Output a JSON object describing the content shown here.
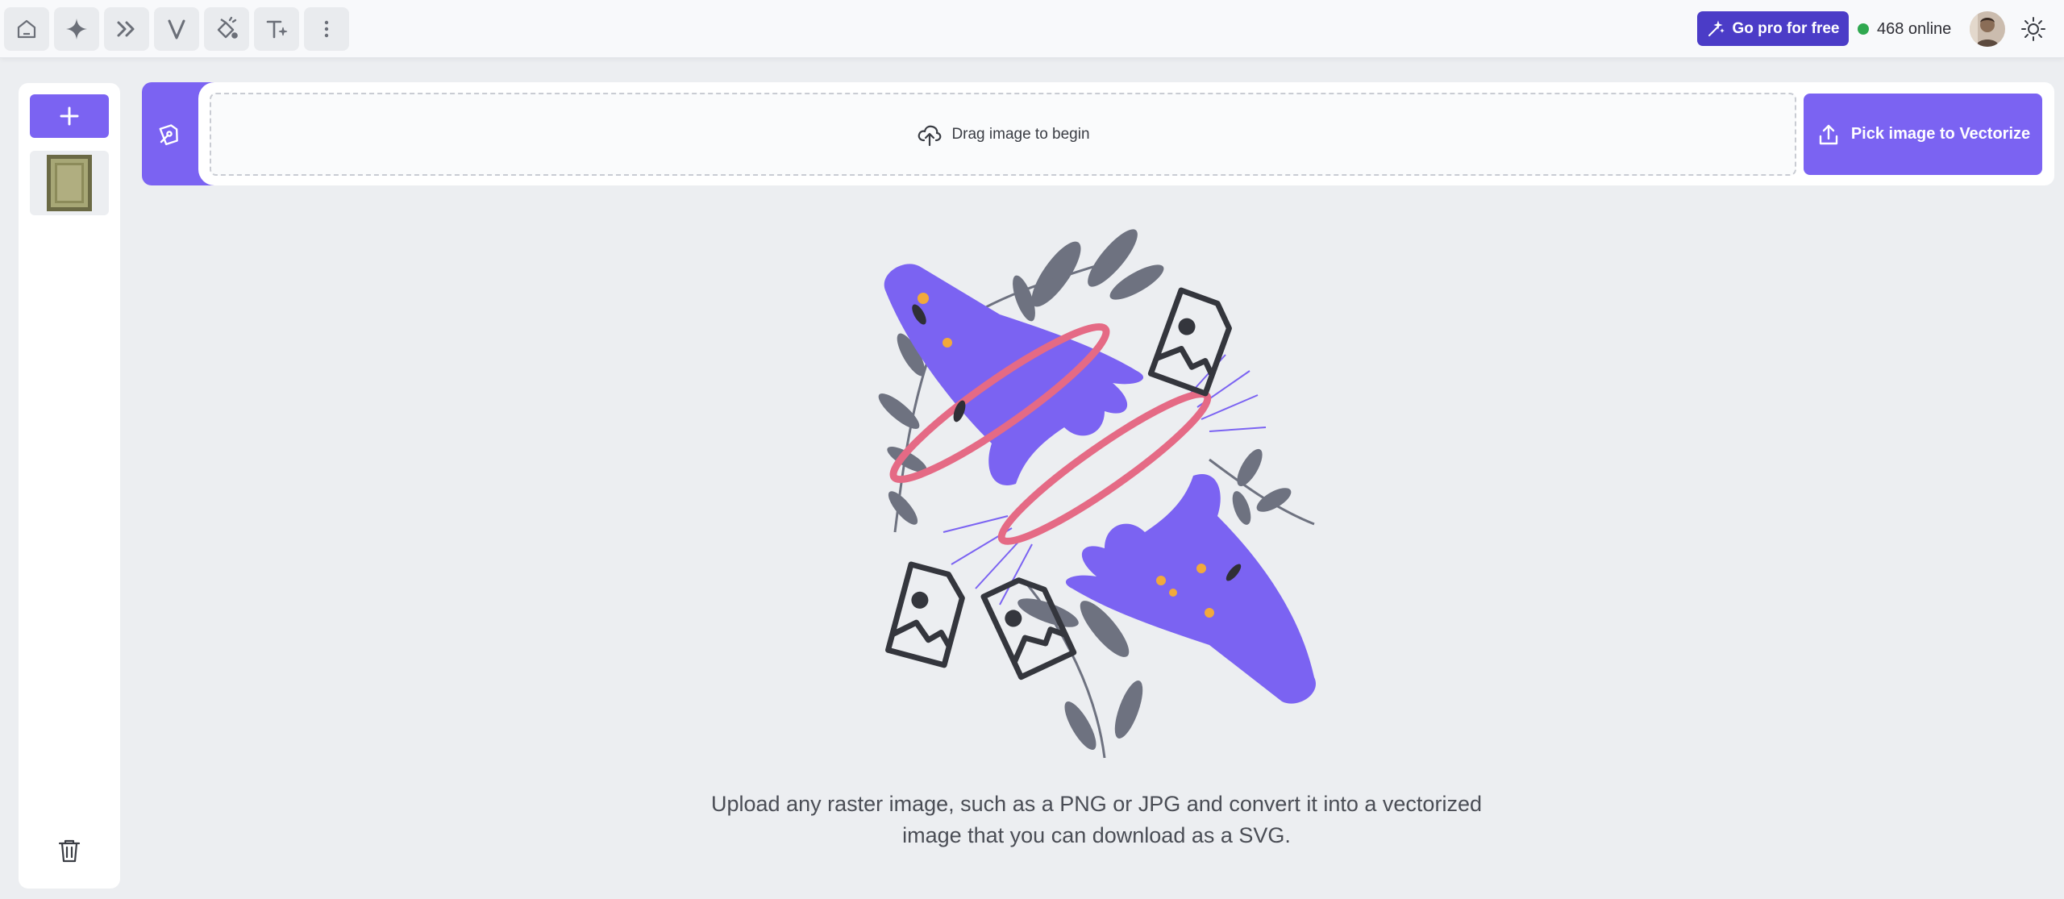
{
  "toolbar": {
    "tools": [
      {
        "name": "home-icon"
      },
      {
        "name": "sparkle-icon"
      },
      {
        "name": "double-chevron-right-icon"
      },
      {
        "name": "vectorize-v-icon"
      },
      {
        "name": "fill-paint-icon"
      },
      {
        "name": "text-ai-icon"
      },
      {
        "name": "more-vertical-icon"
      }
    ],
    "pro_label": "Go pro for free",
    "online_label": "468 online"
  },
  "upload": {
    "drag_label": "Drag image to begin",
    "pick_label": "Pick image to Vectorize"
  },
  "main": {
    "description": "Upload any raster image, such as a PNG or JPG and convert it into a vectorized image that you can download as a SVG."
  },
  "colors": {
    "accent": "#7b63f2",
    "pro": "#4b3cc7",
    "online": "#2fa84f",
    "ring": "#e56a85"
  }
}
